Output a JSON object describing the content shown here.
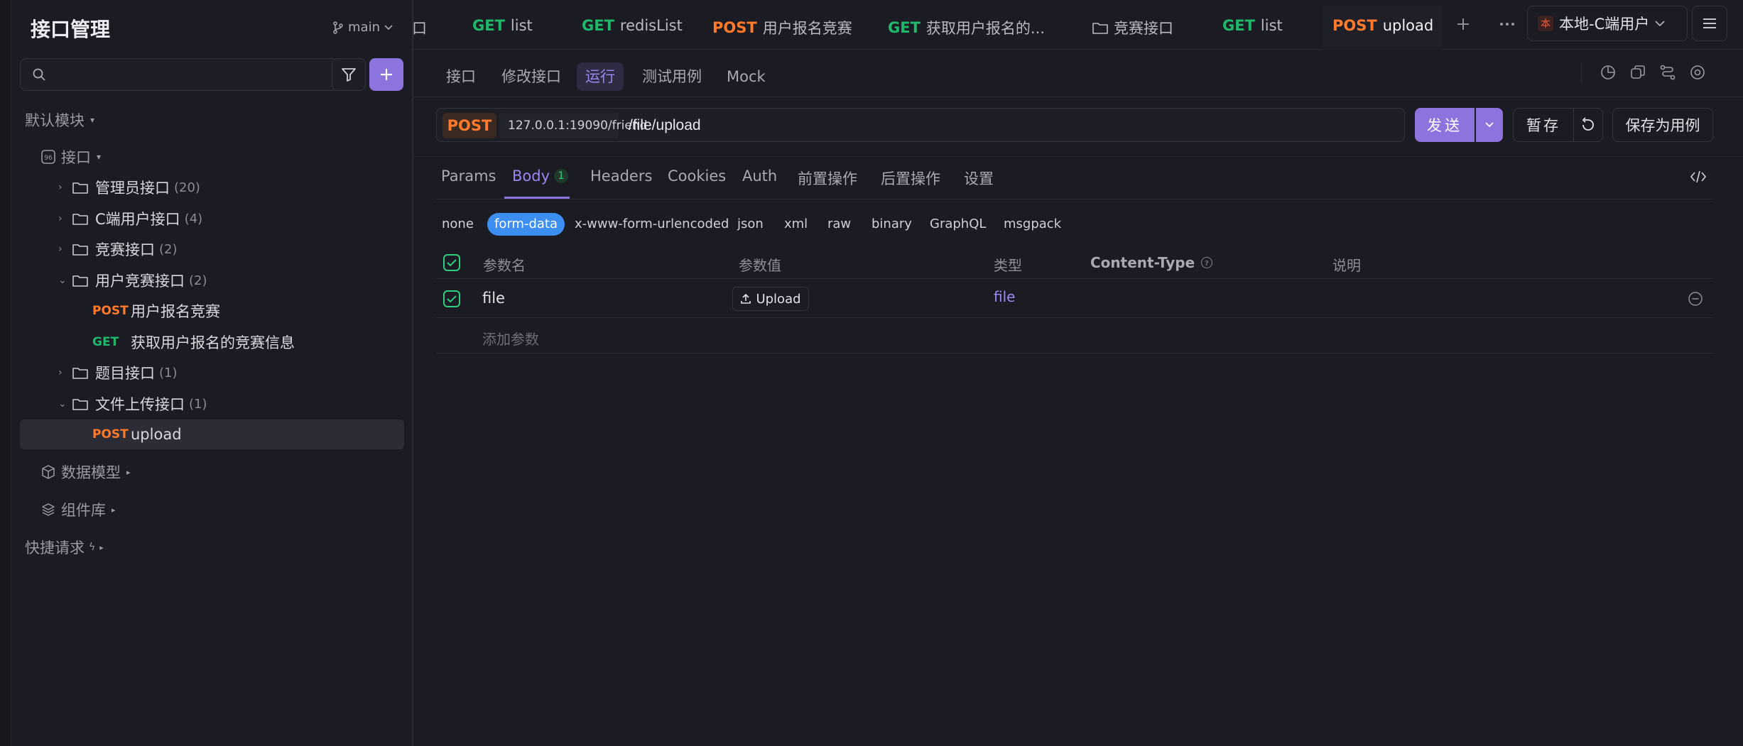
{
  "sidebar": {
    "title": "接口管理",
    "branch": "main",
    "search_placeholder": "",
    "module_label": "默认模块",
    "api_root": "接口",
    "folders": [
      {
        "name": "管理员接口",
        "count": "(20)"
      },
      {
        "name": "C端用户接口",
        "count": "(4)"
      },
      {
        "name": "竞赛接口",
        "count": "(2)"
      },
      {
        "name": "用户竞赛接口",
        "count": "(2)"
      },
      {
        "name": "题目接口",
        "count": "(1)"
      },
      {
        "name": "文件上传接口",
        "count": "(1)"
      }
    ],
    "user_contest_items": [
      {
        "method": "POST",
        "name": "用户报名竞赛"
      },
      {
        "method": "GET",
        "name": "获取用户报名的竞赛信息"
      }
    ],
    "upload_item": {
      "method": "POST",
      "name": "upload"
    },
    "data_model": "数据模型",
    "components": "组件库",
    "quick_request": "快捷请求"
  },
  "tabs": [
    {
      "method": "",
      "label": "口"
    },
    {
      "method": "GET",
      "label": "list"
    },
    {
      "method": "GET",
      "label": "redisList"
    },
    {
      "method": "POST",
      "label": "用户报名竞赛"
    },
    {
      "method": "GET",
      "label": "获取用户报名的..."
    },
    {
      "method": "",
      "label": "竞赛接口"
    },
    {
      "method": "GET",
      "label": "list"
    },
    {
      "method": "POST",
      "label": "upload"
    }
  ],
  "environment": {
    "badge": "本",
    "label": "本地-C端用户"
  },
  "subtabs": [
    "接口",
    "修改接口",
    "运行",
    "测试用例",
    "Mock"
  ],
  "request": {
    "method": "POST",
    "base_url": "127.0.0.1:19090/friend",
    "path": "/file/upload",
    "send_label": "发送",
    "stash_label": "暂存",
    "save_case_label": "保存为用例"
  },
  "param_tabs": {
    "params": "Params",
    "body": "Body",
    "body_count": "1",
    "headers": "Headers",
    "cookies": "Cookies",
    "auth": "Auth",
    "pre": "前置操作",
    "post": "后置操作",
    "settings": "设置"
  },
  "body_types": [
    "none",
    "form-data",
    "x-www-form-urlencoded",
    "json",
    "xml",
    "raw",
    "binary",
    "GraphQL",
    "msgpack"
  ],
  "table": {
    "headers": {
      "name": "参数名",
      "value": "参数值",
      "type": "类型",
      "content_type": "Content-Type",
      "desc": "说明"
    },
    "rows": [
      {
        "name": "file",
        "value_button": "Upload",
        "type": "file"
      }
    ],
    "add_param": "添加参数"
  }
}
